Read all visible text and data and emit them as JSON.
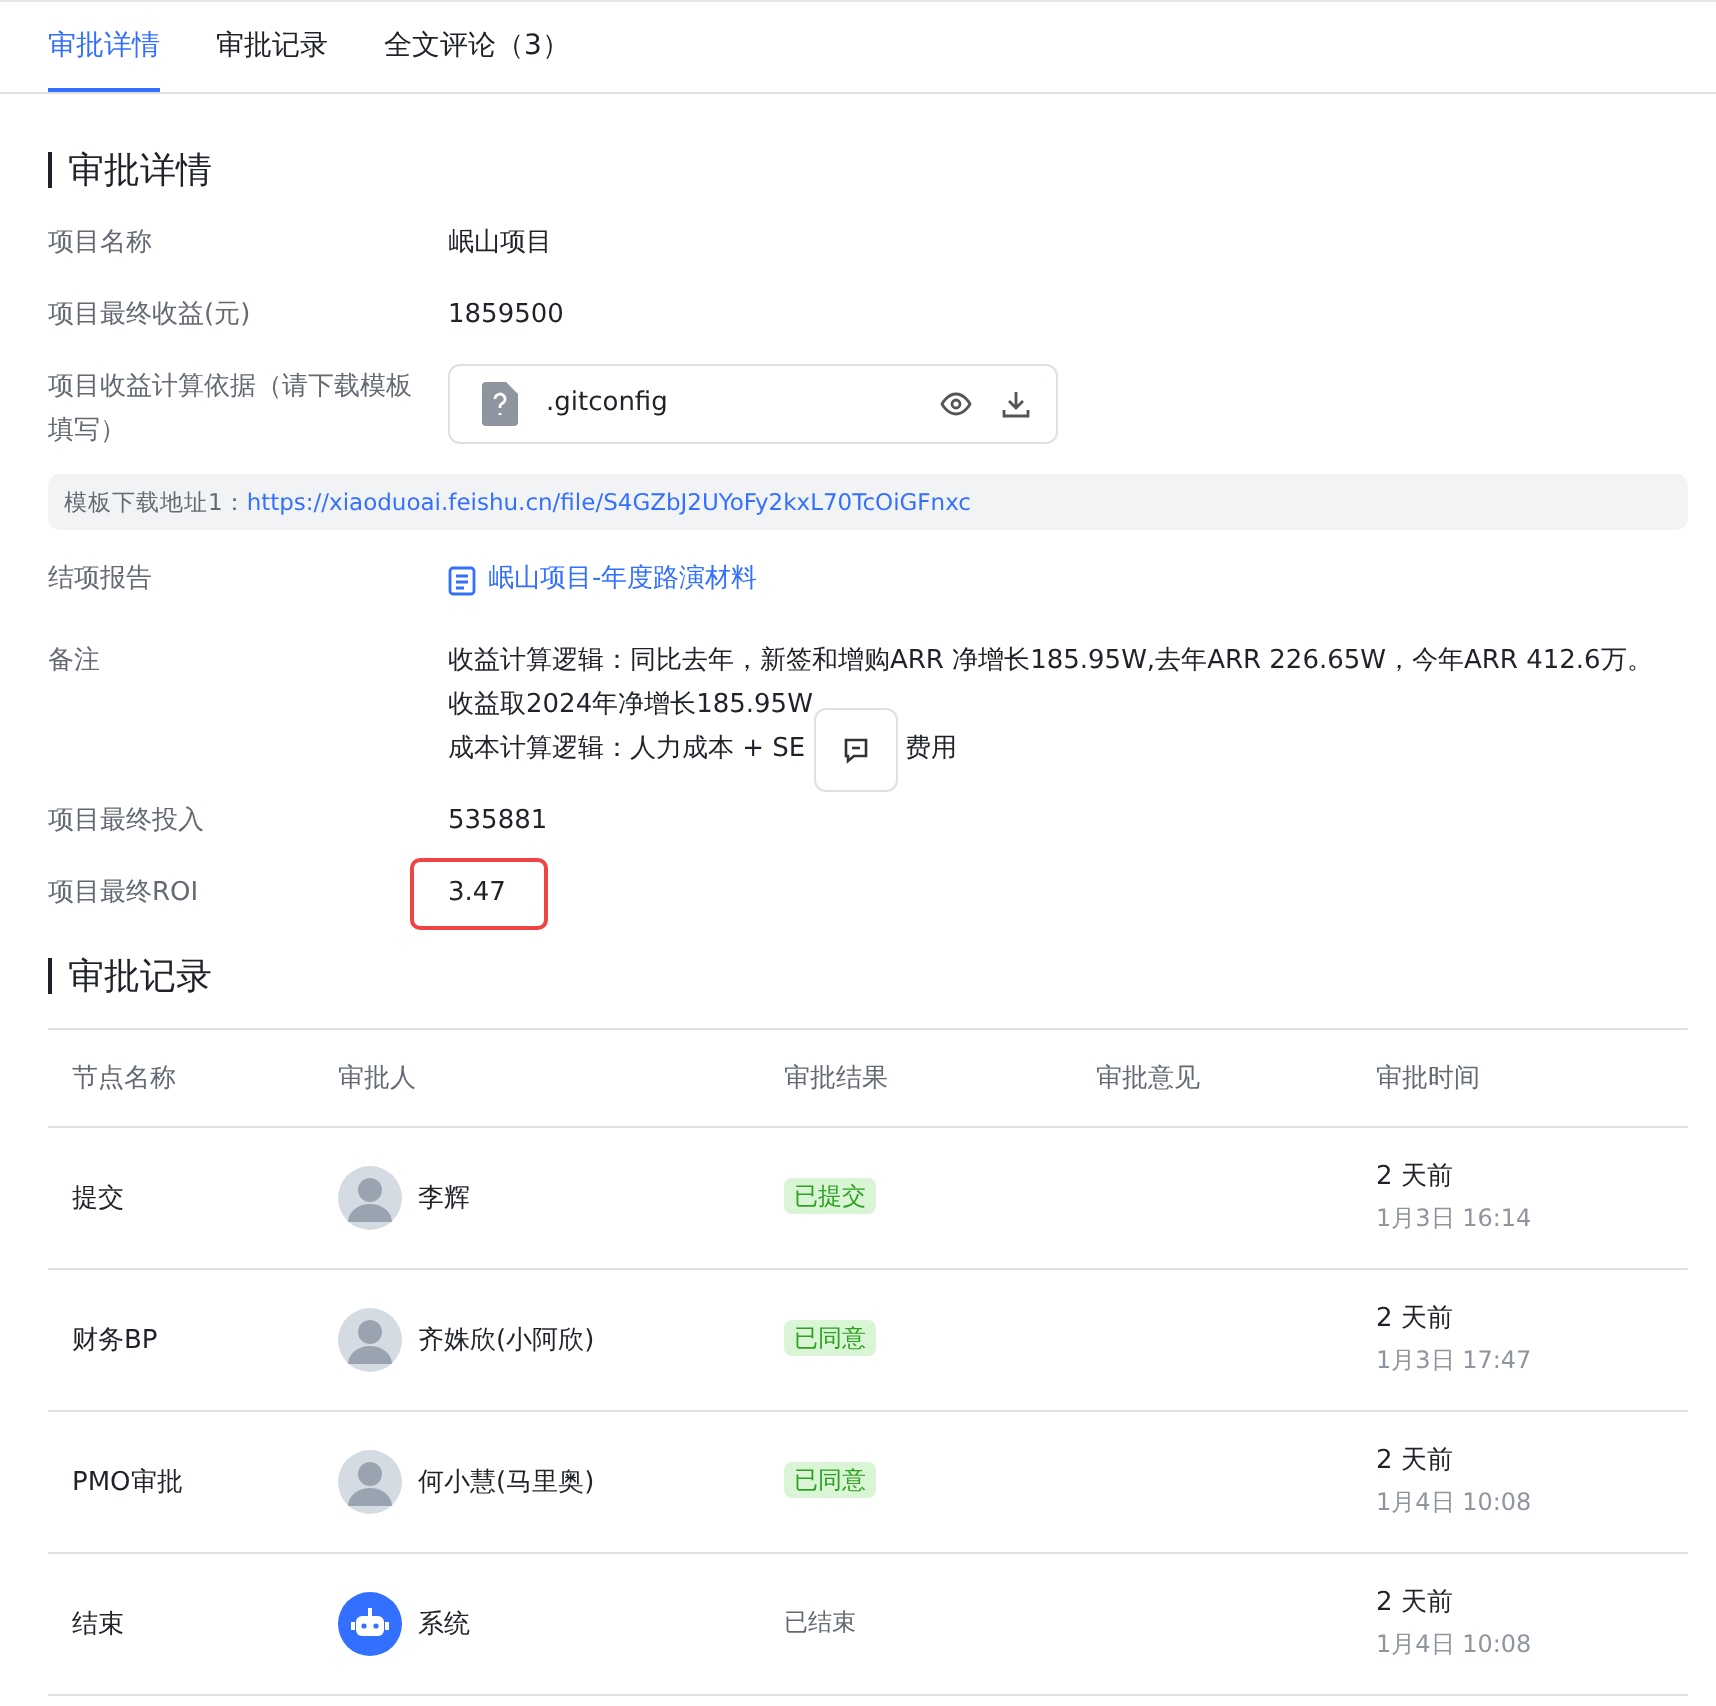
{
  "tabs": [
    {
      "label": "审批详情",
      "selected": true
    },
    {
      "label": "审批记录",
      "selected": false
    },
    {
      "label": "全文评论（3）",
      "selected": false
    }
  ],
  "details": {
    "title": "审批详情",
    "fields": [
      {
        "kind": "text",
        "label": "项目名称",
        "value": "岷山项目",
        "highlighted": false
      },
      {
        "kind": "text",
        "label": "项目最终收益(元)",
        "value": "1859500",
        "highlighted": false
      },
      {
        "kind": "file",
        "label": "项目收益计算依据（请下载模板填写）",
        "file_name": ".gitconfig"
      },
      {
        "kind": "notice",
        "prefix": "模板下载地址1：",
        "link": "https://xiaoduoai.feishu.cn/file/S4GZbJ2UYoFy2kxL70TcOiGFnxc"
      },
      {
        "kind": "doc",
        "label": "结项报告",
        "value": "岷山项目-年度路演材料"
      },
      {
        "kind": "note",
        "label": "备注",
        "lines": [
          "收益计算逻辑：同比去年，新签和增购ARR 净增长185.95W,去年ARR 226.65W，今年ARR 412.6万。",
          "收益取2024年净增长185.95W"
        ],
        "last_line_start": "成本计算逻辑：人力成本 + SE",
        "last_line_end": "费用"
      },
      {
        "kind": "text",
        "label": "项目最终投入",
        "value": "535881",
        "highlighted": false
      },
      {
        "kind": "text",
        "label": "项目最终ROI",
        "value": "3.47",
        "highlighted": true
      }
    ]
  },
  "records": {
    "title": "审批记录",
    "columns": [
      "节点名称",
      "审批人",
      "审批结果",
      "审批意见",
      "审批时间"
    ],
    "rows": [
      {
        "node": "提交",
        "approver": "李辉",
        "avatar": {
          "kind": "person"
        },
        "result": {
          "kind": "tag",
          "text": "已提交"
        },
        "ago": "2 天前",
        "time": "1月3日 16:14"
      },
      {
        "node": "财务BP",
        "approver": "齐姝欣(小阿欣)",
        "avatar": {
          "kind": "person"
        },
        "result": {
          "kind": "tag",
          "text": "已同意"
        },
        "ago": "2 天前",
        "time": "1月3日 17:47"
      },
      {
        "node": "PMO审批",
        "approver": "何小慧(马里奥)",
        "avatar": {
          "kind": "person"
        },
        "result": {
          "kind": "tag",
          "text": "已同意"
        },
        "ago": "2 天前",
        "time": "1月4日 10:08"
      },
      {
        "node": "结束",
        "approver": "系统",
        "avatar": {
          "kind": "bot"
        },
        "result": {
          "kind": "plain",
          "text": "已结束"
        },
        "ago": "2 天前",
        "time": "1月4日 10:08"
      }
    ]
  }
}
